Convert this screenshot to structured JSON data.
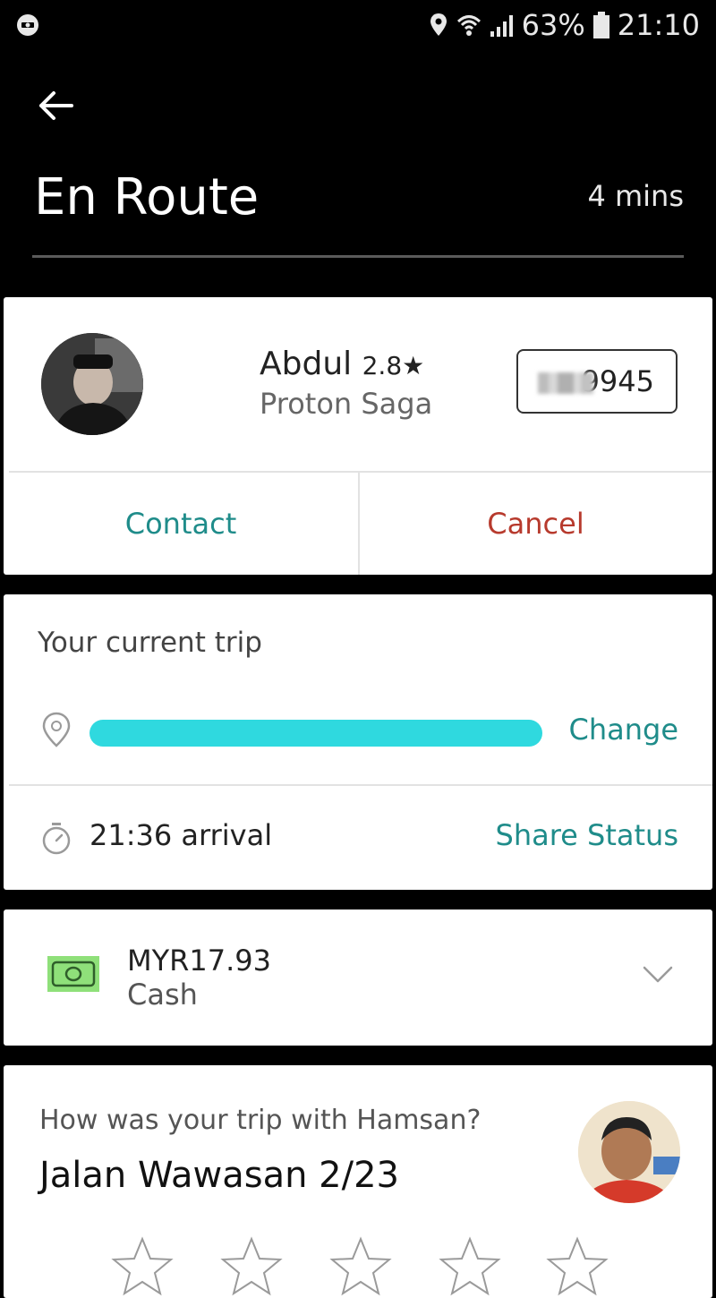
{
  "status_bar": {
    "battery": "63%",
    "time": "21:10",
    "left_icon": "notification-icon",
    "icons": [
      "location-icon",
      "wifi-icon",
      "signal-icon",
      "battery-icon"
    ]
  },
  "header": {
    "back_icon": "back-arrow-icon",
    "title": "En Route",
    "eta": "4 mins"
  },
  "driver": {
    "name": "Abdul",
    "rating": "2.8★",
    "car": "Proton Saga",
    "plate_visible": "9945",
    "contact_label": "Contact",
    "cancel_label": "Cancel"
  },
  "trip": {
    "heading": "Your current trip",
    "change_label": "Change",
    "arrival": "21:36 arrival",
    "share_label": "Share Status"
  },
  "payment": {
    "amount": "MYR17.93",
    "method": "Cash"
  },
  "rating_prompt": {
    "question": "How was your trip with Hamsan?",
    "place": "Jalan Wawasan 2/23",
    "star_count": 5
  },
  "colors": {
    "accent_teal": "#1f8c8a",
    "cancel_red": "#b73a2d",
    "cash_green": "#8fe07a",
    "redaction_cyan": "#2fd9df"
  }
}
